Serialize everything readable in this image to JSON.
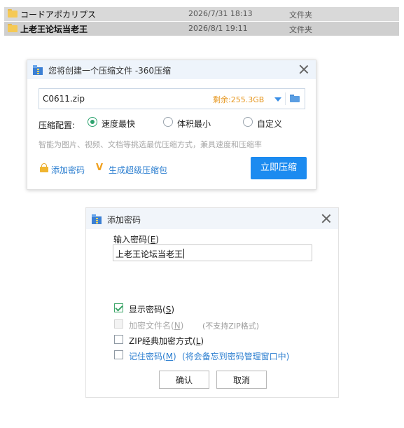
{
  "files": [
    {
      "name": "コードアポカリプス",
      "date": "2026/7/31 18:13",
      "type": "文件夹"
    },
    {
      "name": "上老王论坛当老王",
      "date": "2026/8/1 19:11",
      "type": "文件夹"
    }
  ],
  "compress_dialog": {
    "title": "您将创建一个压缩文件 -360压缩",
    "file_path": "C0611.zip",
    "free_space": "剩余:255.3GB",
    "config_label": "压缩配置:",
    "options": [
      "速度最快",
      "体积最小",
      "自定义"
    ],
    "selected_option": "速度最快",
    "hint": "智能为图片、视频、文档等挑选最优压缩方式，兼具速度和压缩率",
    "add_password": "添加密码",
    "super_package": "生成超级压缩包",
    "compress_button": "立即压缩"
  },
  "password_dialog": {
    "title": "添加密码",
    "input_label": "输入密码(E)",
    "input_label_main": "输入密码(",
    "input_label_key": "E",
    "input_label_end": ")",
    "password_value": "上老王论坛当老王",
    "show_password": {
      "main": "显示密码(",
      "key": "S",
      "end": ")",
      "checked": true
    },
    "encrypt_filename": {
      "main": "加密文件名(",
      "key": "N",
      "end": ")",
      "note": "(不支持ZIP格式)",
      "checked": false,
      "enabled": false
    },
    "zip_classic": {
      "main": "ZIP经典加密方式(",
      "key": "L",
      "end": ")",
      "checked": false
    },
    "remember": {
      "main": "记住密码(",
      "key": "M",
      "end": ")",
      "note": "(将会备忘到密码管理窗口中)",
      "checked": false
    },
    "ok_button": "确认",
    "cancel_button": "取消"
  }
}
